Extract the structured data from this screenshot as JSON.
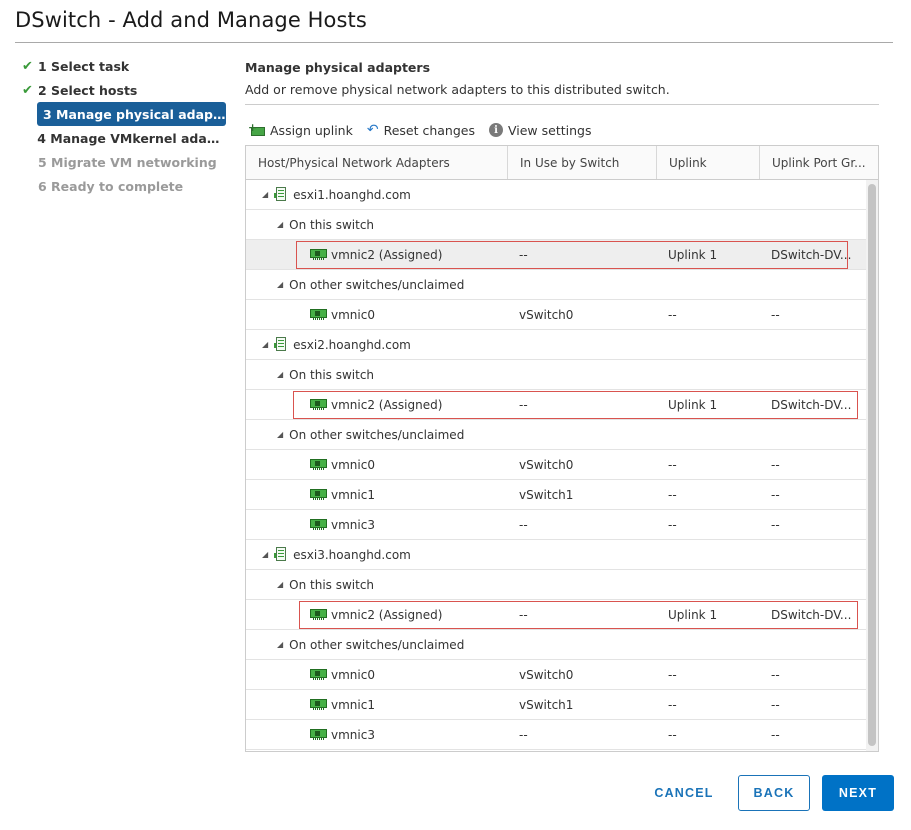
{
  "dialog": {
    "title": "DSwitch - Add and Manage Hosts"
  },
  "steps": [
    {
      "label": "1 Select task",
      "state": "done"
    },
    {
      "label": "2 Select hosts",
      "state": "done"
    },
    {
      "label": "3 Manage physical adapters",
      "state": "active"
    },
    {
      "label": "4 Manage VMkernel adapt...",
      "state": "pending"
    },
    {
      "label": "5 Migrate VM networking",
      "state": "disabled"
    },
    {
      "label": "6 Ready to complete",
      "state": "disabled"
    }
  ],
  "main": {
    "heading": "Manage physical adapters",
    "description": "Add or remove physical network adapters to this distributed switch."
  },
  "toolbar": {
    "assign_uplink": "Assign uplink",
    "reset_changes": "Reset changes",
    "view_settings": "View settings"
  },
  "grid": {
    "columns": [
      "Host/Physical Network Adapters",
      "In Use by Switch",
      "Uplink",
      "Uplink Port Gr..."
    ],
    "rows": [
      {
        "type": "host",
        "name": "esxi1.hoanghd.com"
      },
      {
        "type": "group",
        "name": "On this switch"
      },
      {
        "type": "nic",
        "name": "vmnic2 (Assigned)",
        "in_use": "--",
        "uplink": "Uplink 1",
        "port_group": "DSwitch-DV...",
        "selected": true,
        "highlighted": true
      },
      {
        "type": "group",
        "name": "On other switches/unclaimed"
      },
      {
        "type": "nic",
        "name": "vmnic0",
        "in_use": "vSwitch0",
        "uplink": "--",
        "port_group": "--"
      },
      {
        "type": "host",
        "name": "esxi2.hoanghd.com"
      },
      {
        "type": "group",
        "name": "On this switch"
      },
      {
        "type": "nic",
        "name": "vmnic2 (Assigned)",
        "in_use": "--",
        "uplink": "Uplink 1",
        "port_group": "DSwitch-DV...",
        "highlighted": true
      },
      {
        "type": "group",
        "name": "On other switches/unclaimed"
      },
      {
        "type": "nic",
        "name": "vmnic0",
        "in_use": "vSwitch0",
        "uplink": "--",
        "port_group": "--"
      },
      {
        "type": "nic",
        "name": "vmnic1",
        "in_use": "vSwitch1",
        "uplink": "--",
        "port_group": "--"
      },
      {
        "type": "nic",
        "name": "vmnic3",
        "in_use": "--",
        "uplink": "--",
        "port_group": "--"
      },
      {
        "type": "host",
        "name": "esxi3.hoanghd.com"
      },
      {
        "type": "group",
        "name": "On this switch"
      },
      {
        "type": "nic",
        "name": "vmnic2 (Assigned)",
        "in_use": "--",
        "uplink": "Uplink 1",
        "port_group": "DSwitch-DV...",
        "highlighted": true
      },
      {
        "type": "group",
        "name": "On other switches/unclaimed"
      },
      {
        "type": "nic",
        "name": "vmnic0",
        "in_use": "vSwitch0",
        "uplink": "--",
        "port_group": "--"
      },
      {
        "type": "nic",
        "name": "vmnic1",
        "in_use": "vSwitch1",
        "uplink": "--",
        "port_group": "--"
      },
      {
        "type": "nic",
        "name": "vmnic3",
        "in_use": "--",
        "uplink": "--",
        "port_group": "--"
      }
    ]
  },
  "footer": {
    "cancel": "CANCEL",
    "back": "BACK",
    "next": "NEXT"
  },
  "colors": {
    "accent": "#0072c6",
    "active_step": "#1a5f99",
    "highlight": "#d9534f",
    "check": "#3a9a3a"
  }
}
